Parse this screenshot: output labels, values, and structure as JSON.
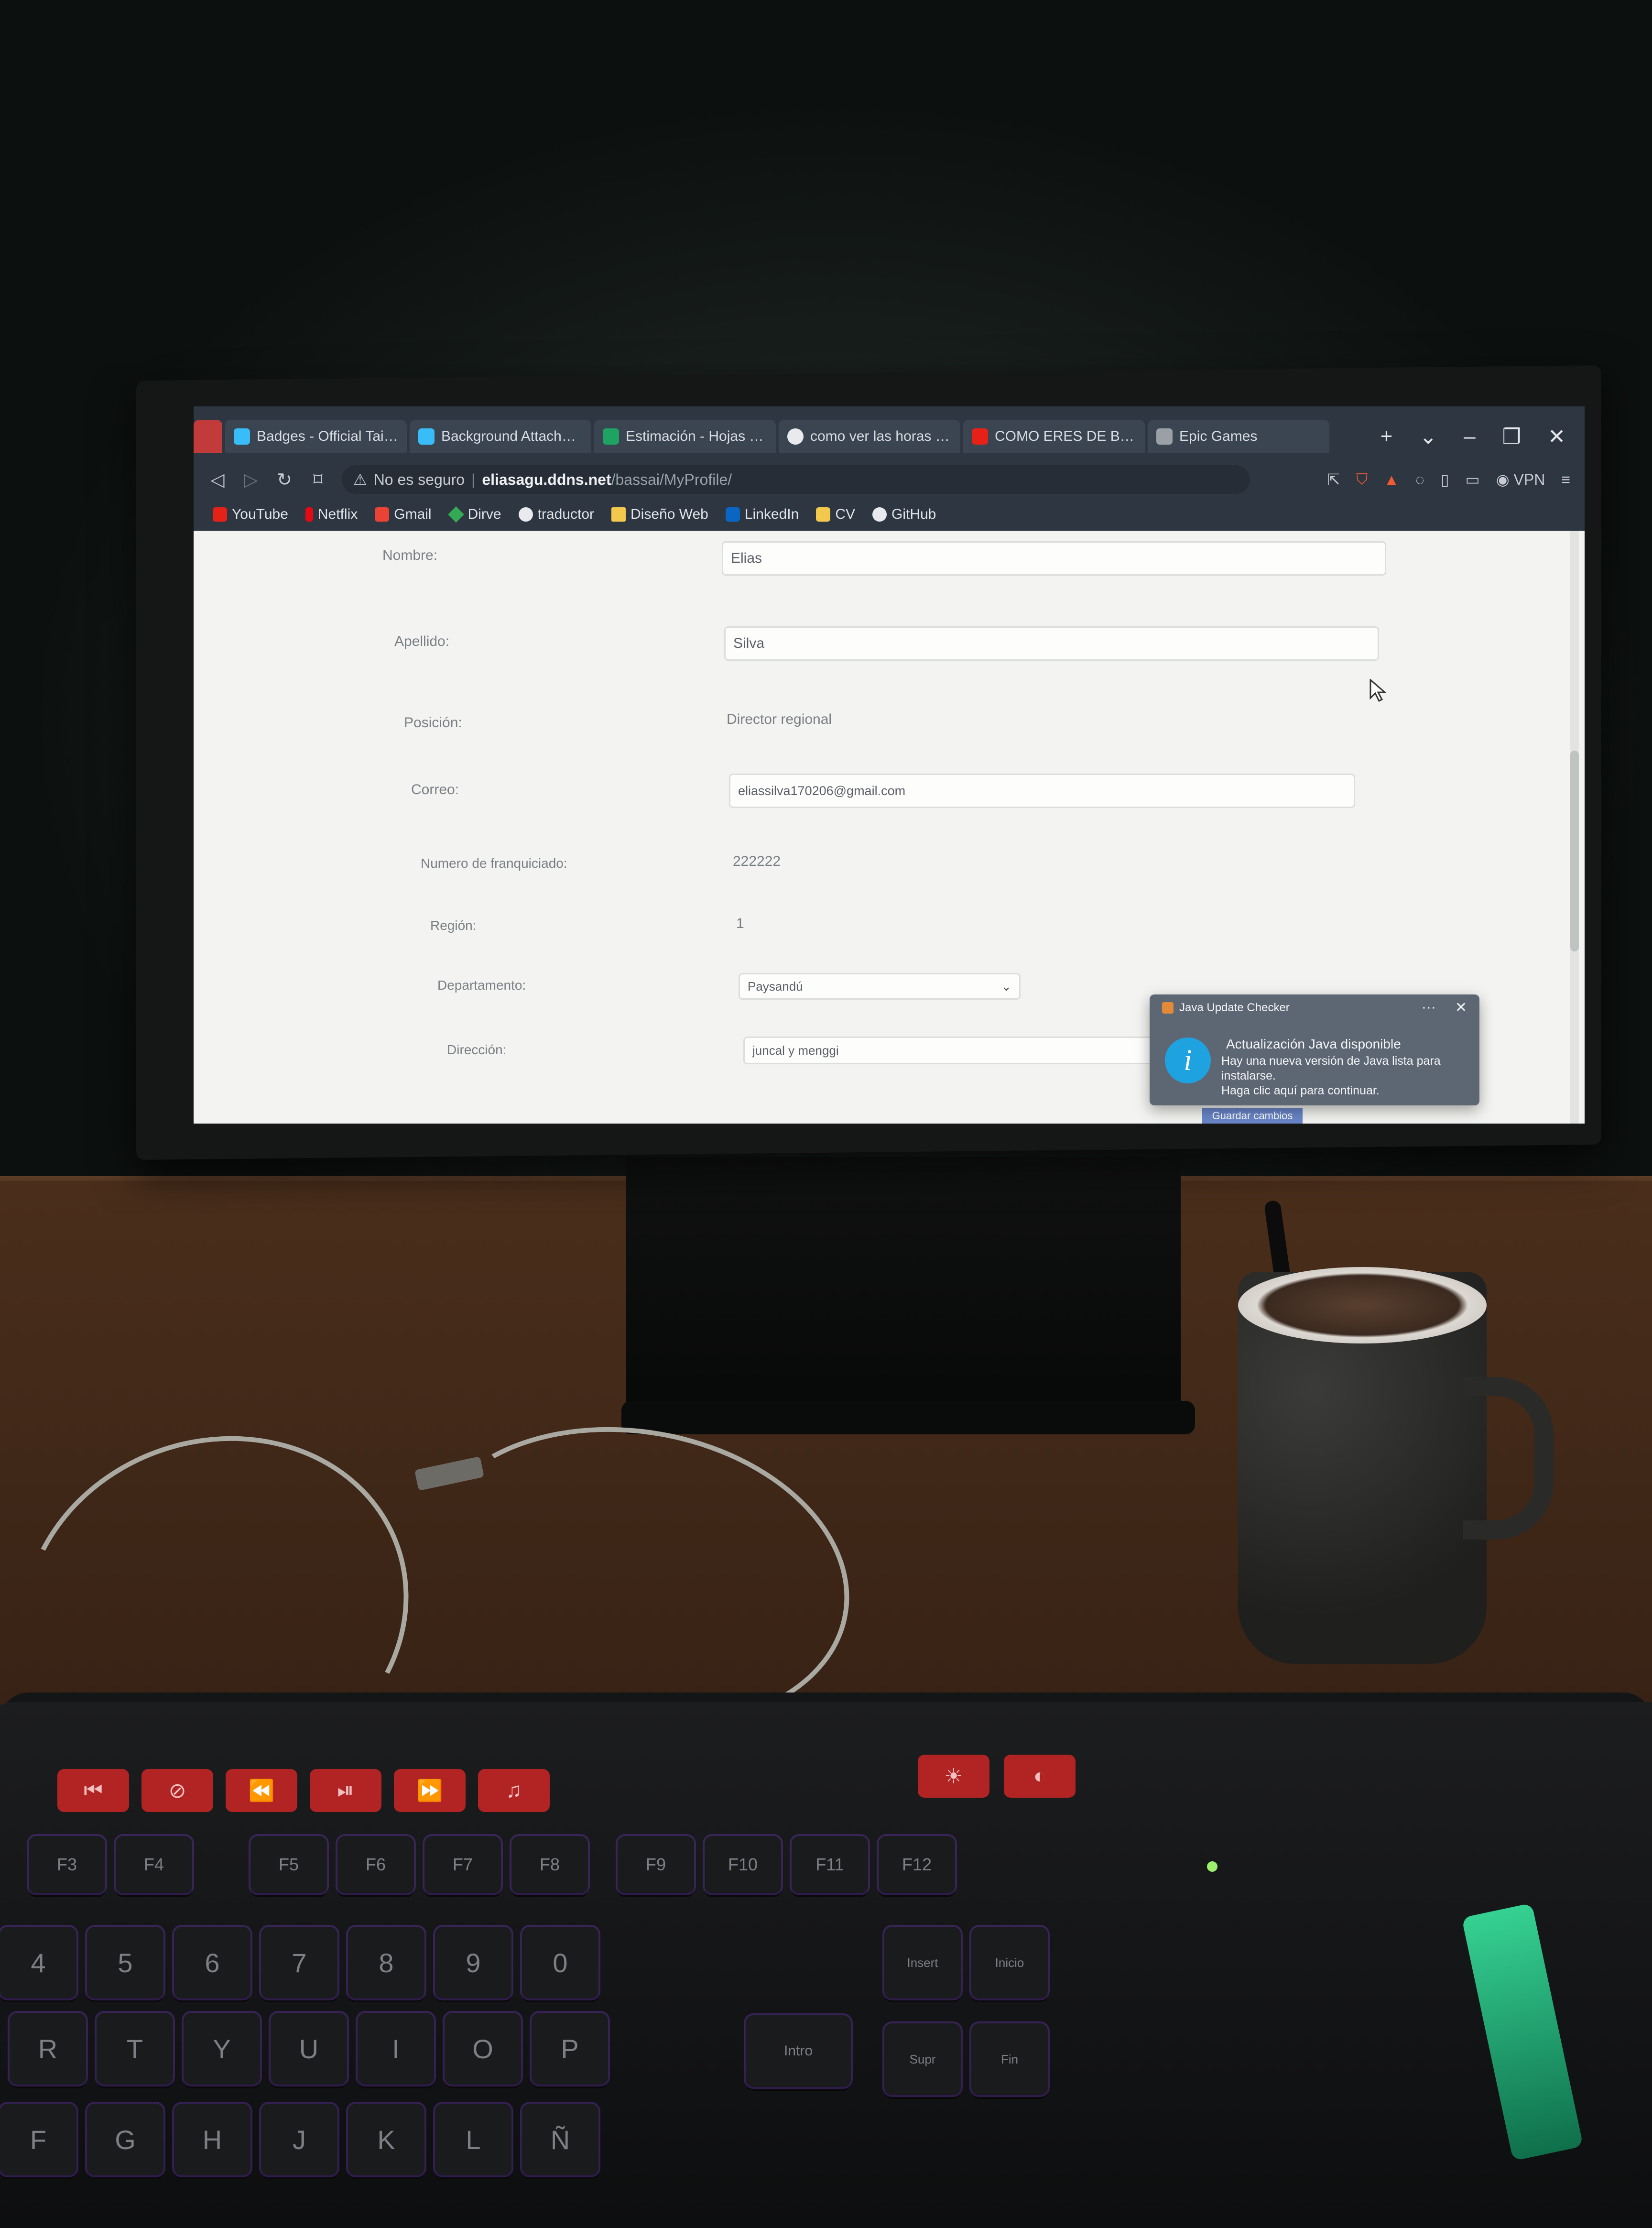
{
  "browser": {
    "tabs": [
      {
        "label": "",
        "color": "#c23a3a"
      },
      {
        "label": "Badges - Official Tailwind",
        "color": "#38bdf8"
      },
      {
        "label": "Background Attachment -",
        "color": "#38bdf8"
      },
      {
        "label": "Estimación - Hojas de cálc",
        "color": "#1ea362"
      },
      {
        "label": "como ver las horas en epi",
        "color": "#e8eaed"
      },
      {
        "label": "COMO ERES DE BUENO S",
        "color": "#e62117"
      },
      {
        "label": "Epic Games",
        "color": "#9aa0a6"
      }
    ],
    "window_controls": {
      "new_tab": "+",
      "dropdown": "⌄",
      "minimize": "–",
      "maximize": "❐",
      "close": "✕"
    },
    "address": {
      "security": "No es seguro",
      "host": "eliasagu.ddns.net",
      "path": "/bassai/MyProfile/"
    },
    "vpn_label": "VPN",
    "bookmarks": [
      {
        "label": "YouTube",
        "color": "#e62117"
      },
      {
        "label": "Netflix",
        "color": "#e50914"
      },
      {
        "label": "Gmail",
        "color": "#ea4335"
      },
      {
        "label": "Dirve",
        "color": "#34a853"
      },
      {
        "label": "traductor",
        "color": "#e8eaed"
      },
      {
        "label": "Diseño Web",
        "color": "#f2c94c"
      },
      {
        "label": "LinkedIn",
        "color": "#0a66c2"
      },
      {
        "label": "CV",
        "color": "#f2c94c"
      },
      {
        "label": "GitHub",
        "color": "#e8eaed"
      }
    ]
  },
  "profile": {
    "nombre_label": "Nombre:",
    "nombre_value": "Elias",
    "apellido_label": "Apellido:",
    "apellido_value": "Silva",
    "posicion_label": "Posición:",
    "posicion_value": "Director regional",
    "correo_label": "Correo:",
    "correo_value": "eliassilva170206@gmail.com",
    "franquiciado_label": "Numero de franquiciado:",
    "franquiciado_value": "222222",
    "region_label": "Región:",
    "region_value": "1",
    "departamento_label": "Departamento:",
    "departamento_value": "Paysandú",
    "direccion_label": "Dirección:",
    "direccion_value": "juncal y menggi",
    "save_label": "Guardar cambios"
  },
  "notification": {
    "app": "Java Update Checker",
    "more": "···",
    "close": "✕",
    "icon_glyph": "i",
    "title": "Actualización Java disponible",
    "body_line1": "Hay una nueva versión de Java lista para instalarse.",
    "body_line2": "Haga clic aquí para continuar."
  },
  "keyboard": {
    "fn_keys": [
      "F3",
      "F4",
      "F5",
      "F6",
      "F7",
      "F8",
      "F9",
      "F10",
      "F11",
      "F12"
    ],
    "number_keys": [
      "4",
      "5",
      "6",
      "7",
      "8",
      "9",
      "0"
    ],
    "row_r": [
      "R",
      "T",
      "Y",
      "U",
      "I",
      "O",
      "P"
    ],
    "row_f": [
      "F",
      "G",
      "H",
      "J",
      "K",
      "L",
      "Ñ"
    ],
    "nav_keys": [
      "Insert",
      "Inicio",
      "Supr",
      "Fin"
    ],
    "enter_label": "Intro"
  }
}
